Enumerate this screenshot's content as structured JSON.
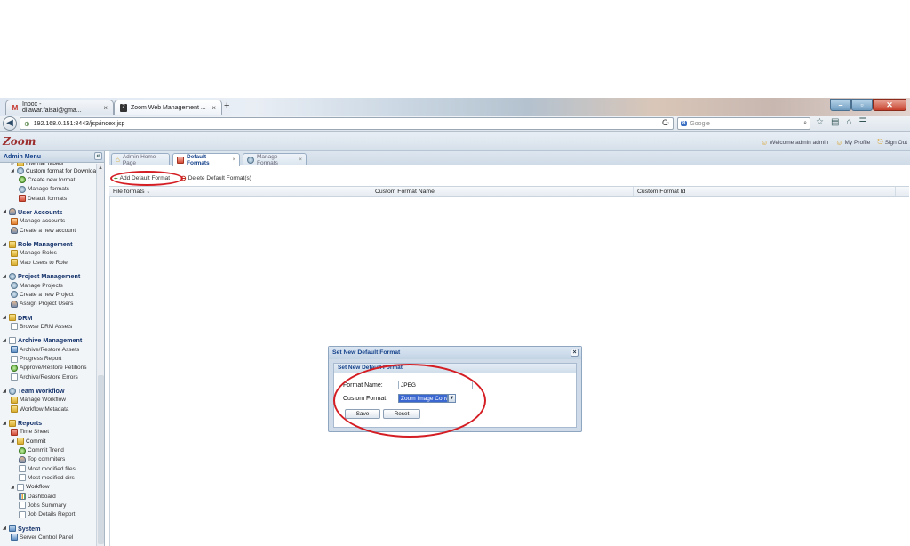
{
  "browser": {
    "tabs": [
      {
        "label": "Inbox - dilawar.faisal@gma...",
        "icon": "gmail-icon"
      },
      {
        "label": "Zoom Web Management ...",
        "icon": "zoom-icon"
      }
    ],
    "new_tab": "+",
    "url": "192.168.0.151:8443/jsp/index.jsp",
    "search_placeholder": "Google",
    "search_engine": "8",
    "tab_close": "×"
  },
  "app": {
    "logo": "Zoom",
    "header_links": {
      "welcome": "Welcome admin admin",
      "profile": "My Profile",
      "signout": "Sign Out"
    }
  },
  "sidebar": {
    "title": "Admin Menu",
    "collapse": "«",
    "partial_item": "Internal Tables",
    "custom_format": {
      "label": "Custom format for Downloa",
      "items": [
        "Create new format",
        "Manage formats",
        "Default formats"
      ]
    },
    "groups": [
      {
        "label": "User Accounts",
        "items": [
          "Manage accounts",
          "Create a new account"
        ]
      },
      {
        "label": "Role Management",
        "items": [
          "Manage Roles",
          "Map Users to Role"
        ]
      },
      {
        "label": "Project Management",
        "items": [
          "Manage Projects",
          "Create a new Project",
          "Assign Project Users"
        ]
      },
      {
        "label": "DRM",
        "items": [
          "Browse DRM Assets"
        ]
      },
      {
        "label": "Archive Management",
        "items": [
          "Archive/Restore Assets",
          "Progress Report",
          "Approve/Restore Petitions",
          "Archive/Restore Errors"
        ]
      },
      {
        "label": "Team Workflow",
        "items": [
          "Manage Workflow",
          "Workflow Metadata"
        ]
      }
    ],
    "reports": {
      "label": "Reports",
      "time_sheet": "Time Sheet",
      "commit": {
        "label": "Commit",
        "items": [
          "Commit Trend",
          "Top commiters",
          "Most modified files",
          "Most modified dirs"
        ]
      },
      "workflow": {
        "label": "Workflow",
        "items": [
          "Dashboard",
          "Jobs Summary",
          "Job Details Report"
        ]
      }
    },
    "system": {
      "label": "System",
      "items": [
        "Server Control Panel"
      ]
    }
  },
  "content": {
    "tabs": [
      {
        "label": "Admin Home Page",
        "active": false,
        "closable": false
      },
      {
        "label": "Default Formats",
        "active": true,
        "closable": true
      },
      {
        "label": "Manage Formats",
        "active": false,
        "closable": true
      }
    ],
    "toolbar": {
      "add": "Add Default Format",
      "delete": "Delete Default Format(s)"
    },
    "columns": [
      "File formats",
      "Custom Format Name",
      "Custom Format Id"
    ]
  },
  "dialog": {
    "title": "Set New Default Format",
    "fieldset_title": "Set New Default Format",
    "format_name_label": "Format Name:",
    "format_name_value": "JPEG",
    "custom_format_label": "Custom Format:",
    "custom_format_value": "Zoom Image Conv",
    "save": "Save",
    "reset": "Reset"
  },
  "colors": {
    "highlight_ellipse": "#d41e24",
    "header_text": "#15428b",
    "selected": "#3b67d1"
  }
}
